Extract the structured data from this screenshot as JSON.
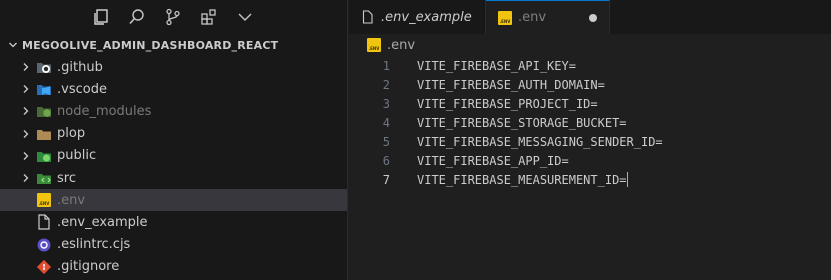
{
  "explorer": {
    "project_title": "MEGOOLIVE_ADMIN_DASHBOARD_REACT",
    "items": [
      {
        "label": ".github",
        "kind": "folder",
        "icon": "github-folder-icon",
        "dim": false
      },
      {
        "label": ".vscode",
        "kind": "folder",
        "icon": "vscode-folder-icon",
        "dim": false
      },
      {
        "label": "node_modules",
        "kind": "folder",
        "icon": "node-folder-icon",
        "dim": true
      },
      {
        "label": "plop",
        "kind": "folder",
        "icon": "folder-icon",
        "dim": false
      },
      {
        "label": "public",
        "kind": "folder",
        "icon": "public-folder-icon",
        "dim": false
      },
      {
        "label": "src",
        "kind": "folder",
        "icon": "src-folder-icon",
        "dim": false
      },
      {
        "label": ".env",
        "kind": "file",
        "icon": "env-file-icon",
        "dim": true,
        "selected": true
      },
      {
        "label": ".env_example",
        "kind": "file",
        "icon": "file-icon",
        "dim": false
      },
      {
        "label": ".eslintrc.cjs",
        "kind": "file",
        "icon": "eslint-icon",
        "dim": false
      },
      {
        "label": ".gitignore",
        "kind": "file",
        "icon": "git-icon",
        "dim": false
      }
    ]
  },
  "tabs": [
    {
      "label": ".env_example",
      "icon": "file-icon",
      "active": false
    },
    {
      "label": ".env",
      "icon": "env-file-icon",
      "active": true,
      "modified": true
    }
  ],
  "breadcrumb": {
    "file": ".env"
  },
  "editor": {
    "lines": [
      {
        "num": "1",
        "text": "VITE_FIREBASE_API_KEY="
      },
      {
        "num": "2",
        "text": "VITE_FIREBASE_AUTH_DOMAIN="
      },
      {
        "num": "3",
        "text": "VITE_FIREBASE_PROJECT_ID="
      },
      {
        "num": "4",
        "text": "VITE_FIREBASE_STORAGE_BUCKET="
      },
      {
        "num": "5",
        "text": "VITE_FIREBASE_MESSAGING_SENDER_ID="
      },
      {
        "num": "6",
        "text": "VITE_FIREBASE_APP_ID="
      },
      {
        "num": "7",
        "text": "VITE_FIREBASE_MEASUREMENT_ID="
      }
    ],
    "current_line": 7
  },
  "env_icon_text": ".ENV",
  "colors": {
    "accent": "#0078d4",
    "env_yellow": "#f1c40f",
    "selection": "#37373d"
  }
}
